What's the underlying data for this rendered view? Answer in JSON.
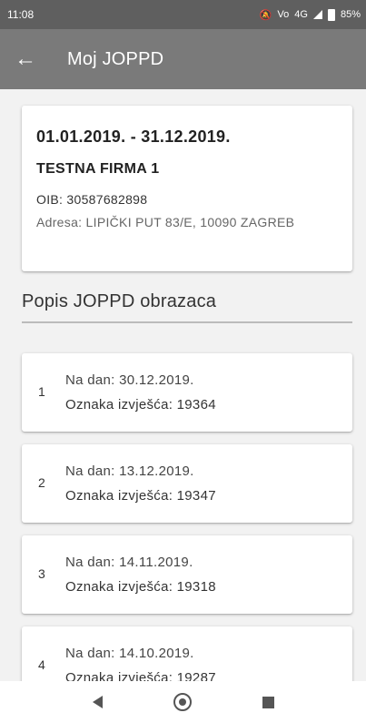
{
  "status_bar": {
    "time": "11:08",
    "network": "4G",
    "battery": "85%",
    "icons": [
      "mute-icon",
      "volte-icon",
      "signal-icon",
      "battery-icon"
    ]
  },
  "app_bar": {
    "title": "Moj JOPPD",
    "back_icon": "arrow-left-icon"
  },
  "summary": {
    "period": "01.01.2019. - 31.12.2019.",
    "company": "TESTNA FIRMA 1",
    "oib": "OIB: 30587682898",
    "address": "Adresa: LIPIČKI PUT 83/E, 10090 ZAGREB"
  },
  "section": {
    "title": "Popis JOPPD obrazaca"
  },
  "reports": [
    {
      "index": "1",
      "date": "Na dan: 30.12.2019.",
      "oznaka": "Oznaka izvješća: 19364"
    },
    {
      "index": "2",
      "date": "Na dan: 13.12.2019.",
      "oznaka": "Oznaka izvješća: 19347"
    },
    {
      "index": "3",
      "date": "Na dan: 14.11.2019.",
      "oznaka": "Oznaka izvješća: 19318"
    },
    {
      "index": "4",
      "date": "Na dan: 14.10.2019.",
      "oznaka": "Oznaka izvješća: 19287"
    }
  ],
  "nav_bar": {
    "icons": [
      "back-triangle-icon",
      "home-circle-icon",
      "recent-square-icon"
    ]
  },
  "colors": {
    "status_bar": "#5f5f5f",
    "app_bar": "#7a7a7a",
    "background": "#f2f2f2"
  }
}
